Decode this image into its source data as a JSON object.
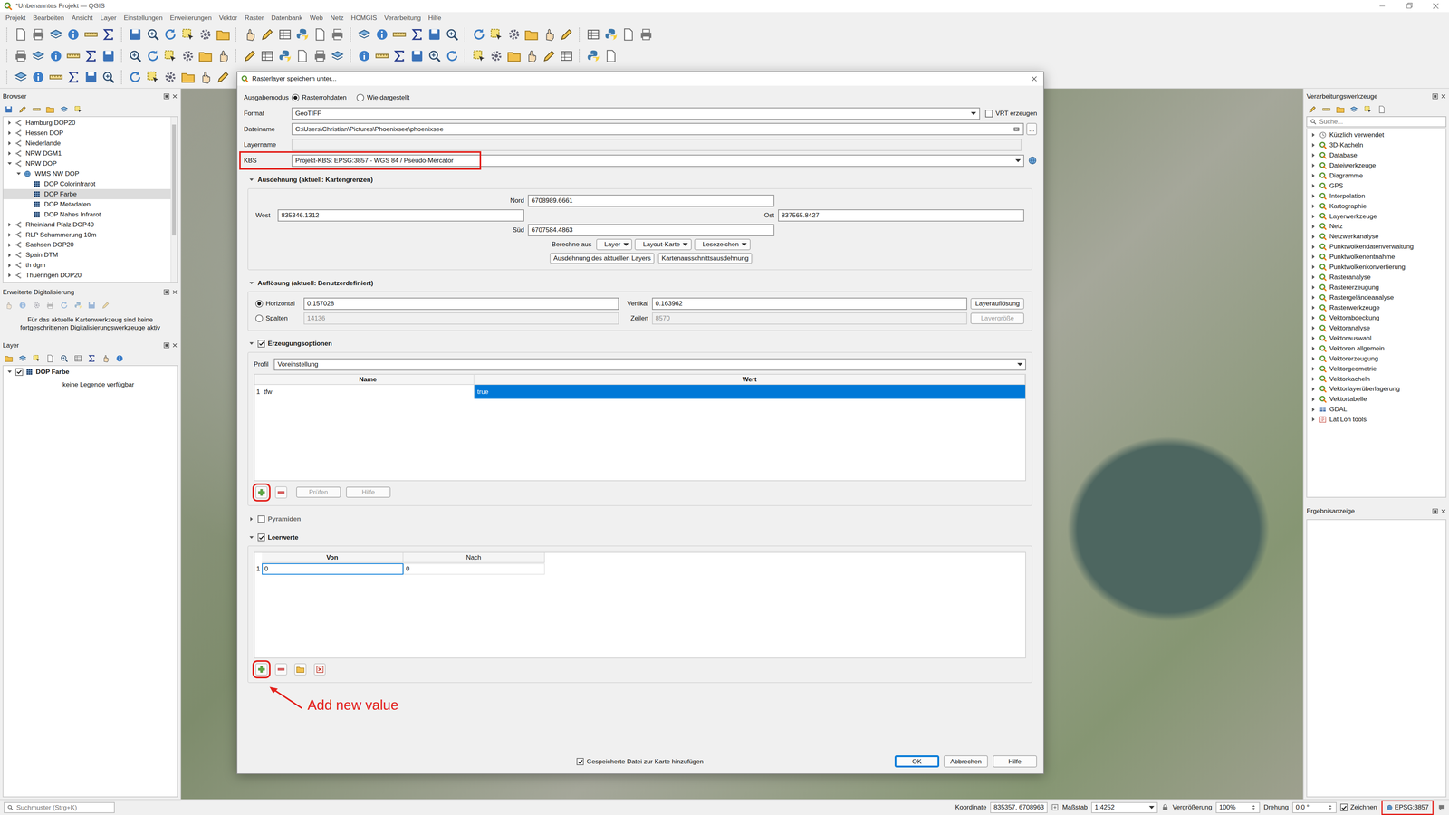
{
  "window": {
    "title": "*Unbenanntes Projekt — QGIS"
  },
  "menu": [
    "Projekt",
    "Bearbeiten",
    "Ansicht",
    "Layer",
    "Einstellungen",
    "Erweiterungen",
    "Vektor",
    "Raster",
    "Datenbank",
    "Web",
    "Netz",
    "HCMGIS",
    "Verarbeitung",
    "Hilfe"
  ],
  "browser": {
    "title": "Browser",
    "items": [
      {
        "label": "Hamburg DOP20",
        "depth": 0,
        "kind": "connection",
        "expanded": false,
        "selected": false
      },
      {
        "label": "Hessen DOP",
        "depth": 0,
        "kind": "connection",
        "expanded": false,
        "selected": false
      },
      {
        "label": "Niederlande",
        "depth": 0,
        "kind": "connection",
        "expanded": false,
        "selected": false
      },
      {
        "label": "NRW DGM1",
        "depth": 0,
        "kind": "connection",
        "expanded": false,
        "selected": false
      },
      {
        "label": "NRW DOP",
        "depth": 0,
        "kind": "connection",
        "expanded": true,
        "selected": false
      },
      {
        "label": "WMS NW DOP",
        "depth": 1,
        "kind": "service",
        "expanded": true,
        "selected": false
      },
      {
        "label": "DOP Colorinfrarot",
        "depth": 2,
        "kind": "layer",
        "expanded": false,
        "selected": false
      },
      {
        "label": "DOP Farbe",
        "depth": 2,
        "kind": "layer",
        "expanded": false,
        "selected": true
      },
      {
        "label": "DOP Metadaten",
        "depth": 2,
        "kind": "layer",
        "expanded": false,
        "selected": false
      },
      {
        "label": "DOP Nahes Infrarot",
        "depth": 2,
        "kind": "layer",
        "expanded": false,
        "selected": false
      },
      {
        "label": "Rheinland Pfalz DOP40",
        "depth": 0,
        "kind": "connection",
        "expanded": false,
        "selected": false
      },
      {
        "label": "RLP Schummerung 10m",
        "depth": 0,
        "kind": "connection",
        "expanded": false,
        "selected": false
      },
      {
        "label": "Sachsen DOP20",
        "depth": 0,
        "kind": "connection",
        "expanded": false,
        "selected": false
      },
      {
        "label": "Spain DTM",
        "depth": 0,
        "kind": "connection",
        "expanded": false,
        "selected": false
      },
      {
        "label": "th dgm",
        "depth": 0,
        "kind": "connection",
        "expanded": false,
        "selected": false
      },
      {
        "label": "Thueringen DOP20",
        "depth": 0,
        "kind": "connection",
        "expanded": false,
        "selected": false
      }
    ]
  },
  "digitizing": {
    "title": "Erweiterte Digitalisierung",
    "message": "Für das aktuelle Kartenwerkzeug sind keine fortgeschrittenen Digitalisierungswerkzeuge aktiv"
  },
  "layers": {
    "title": "Layer",
    "items": [
      {
        "label": "DOP Farbe",
        "checked": true,
        "expanded": true
      }
    ],
    "legend": "keine Legende verfügbar"
  },
  "locator": {
    "placeholder": "Suchmuster (Strg+K)"
  },
  "processing": {
    "title": "Verarbeitungswerkzeuge",
    "search": {
      "placeholder": "Suche..."
    },
    "items": [
      {
        "label": "Kürzlich verwendet",
        "kind": "recent",
        "expanded": false
      },
      {
        "label": "3D-Kacheln",
        "kind": "qgis",
        "expanded": false
      },
      {
        "label": "Database",
        "kind": "qgis",
        "expanded": false
      },
      {
        "label": "Dateiwerkzeuge",
        "kind": "qgis",
        "expanded": false
      },
      {
        "label": "Diagramme",
        "kind": "qgis",
        "expanded": false
      },
      {
        "label": "GPS",
        "kind": "qgis",
        "expanded": false
      },
      {
        "label": "Interpolation",
        "kind": "qgis",
        "expanded": false
      },
      {
        "label": "Kartographie",
        "kind": "qgis",
        "expanded": false
      },
      {
        "label": "Layerwerkzeuge",
        "kind": "qgis",
        "expanded": false
      },
      {
        "label": "Netz",
        "kind": "qgis",
        "expanded": false
      },
      {
        "label": "Netzwerkanalyse",
        "kind": "qgis",
        "expanded": false
      },
      {
        "label": "Punktwolkendatenverwaltung",
        "kind": "qgis",
        "expanded": false
      },
      {
        "label": "Punktwolkenentnahme",
        "kind": "qgis",
        "expanded": false
      },
      {
        "label": "Punktwolkenkonvertierung",
        "kind": "qgis",
        "expanded": false
      },
      {
        "label": "Rasteranalyse",
        "kind": "qgis",
        "expanded": false
      },
      {
        "label": "Rastererzeugung",
        "kind": "qgis",
        "expanded": false
      },
      {
        "label": "Rastergeländeanalyse",
        "kind": "qgis",
        "expanded": false
      },
      {
        "label": "Rasterwerkzeuge",
        "kind": "qgis",
        "expanded": false
      },
      {
        "label": "Vektorabdeckung",
        "kind": "qgis",
        "expanded": false
      },
      {
        "label": "Vektoranalyse",
        "kind": "qgis",
        "expanded": false
      },
      {
        "label": "Vektorauswahl",
        "kind": "qgis",
        "expanded": false
      },
      {
        "label": "Vektoren allgemein",
        "kind": "qgis",
        "expanded": false
      },
      {
        "label": "Vektorerzeugung",
        "kind": "qgis",
        "expanded": false
      },
      {
        "label": "Vektorgeometrie",
        "kind": "qgis",
        "expanded": false
      },
      {
        "label": "Vektorkacheln",
        "kind": "qgis",
        "expanded": false
      },
      {
        "label": "Vektorlayerüberlagerung",
        "kind": "qgis",
        "expanded": false
      },
      {
        "label": "Vektortabelle",
        "kind": "qgis",
        "expanded": false
      },
      {
        "label": "GDAL",
        "kind": "gdal",
        "expanded": false
      },
      {
        "label": "Lat Lon tools",
        "kind": "plugin",
        "expanded": false
      }
    ]
  },
  "results": {
    "title": "Ergebnisanzeige"
  },
  "status_bar": {
    "coordinate_label": "Koordinate",
    "coordinate": "835357, 6708963",
    "scale_label": "Maßstab",
    "scale": "1:4252",
    "magnifier_label": "Vergrößerung",
    "magnifier": "100%",
    "rotation_label": "Drehung",
    "rotation": "0.0 °",
    "render": {
      "label": "Zeichnen",
      "checked": true
    },
    "crs": {
      "label": "EPSG:3857",
      "highlighted": true
    }
  },
  "dialog": {
    "title": "Rasterlayer speichern unter...",
    "output_mode": {
      "label": "Ausgabemodus",
      "options": [
        {
          "label": "Rasterrohdaten",
          "selected": true
        },
        {
          "label": "Wie dargestellt",
          "selected": false
        }
      ]
    },
    "format": {
      "label": "Format",
      "value": "GeoTIFF"
    },
    "vrt": {
      "label": "VRT erzeugen",
      "checked": false
    },
    "filename": {
      "label": "Dateiname",
      "value": "C:\\Users\\Christian\\Pictures\\Phoenixsee\\phoenixsee",
      "browse": "..."
    },
    "layername": {
      "label": "Layername",
      "value": "",
      "disabled": true
    },
    "crs": {
      "label": "KBS",
      "value": "Projekt-KBS: EPSG:3857 - WGS 84 / Pseudo-Mercator",
      "highlighted": true
    },
    "extent": {
      "title": "Ausdehnung (aktuell: Kartengrenzen)",
      "expanded": true,
      "north": {
        "label": "Nord",
        "value": "6708989.6661"
      },
      "west": {
        "label": "West",
        "value": "835346.1312"
      },
      "east": {
        "label": "Ost",
        "value": "837565.8427"
      },
      "south": {
        "label": "Süd",
        "value": "6707584.4863"
      },
      "calc_label": "Berechne aus",
      "calc_menus": [
        "Layer",
        "Layout-Karte",
        "Lesezeichen"
      ],
      "buttons": [
        "Ausdehnung des aktuellen Layers",
        "Kartenausschnittsausdehnung"
      ]
    },
    "resolution": {
      "title": "Auflösung (aktuell: Benutzerdefiniert)",
      "expanded": true,
      "rows": [
        {
          "label": "Horizontal",
          "selected": true,
          "value": "0.157028",
          "label2": "Vertikal",
          "value2": "0.163962",
          "button": "Layerauflösung",
          "disabled": false
        },
        {
          "label": "Spalten",
          "selected": false,
          "value": "14136",
          "label2": "Zeilen",
          "value2": "8570",
          "button": "Layergröße",
          "disabled": true
        }
      ]
    },
    "creation": {
      "title": "Erzeugungsoptionen",
      "checked": true,
      "expanded": true,
      "profile_label": "Profil",
      "profile": "Voreinstellung",
      "columns": [
        "Name",
        "Wert"
      ],
      "rows": [
        {
          "num": "1",
          "name": "tfw",
          "value": "true",
          "selected": true
        }
      ],
      "tools": [
        {
          "kind": "add",
          "highlighted": true
        },
        {
          "kind": "remove",
          "highlighted": false
        }
      ],
      "buttons": [
        {
          "label": "Prüfen",
          "disabled": true
        },
        {
          "label": "Hilfe",
          "disabled": true
        }
      ]
    },
    "pyramids": {
      "title": "Pyramiden",
      "checked": false,
      "expanded": false
    },
    "nodata": {
      "title": "Leerwerte",
      "checked": true,
      "expanded": true,
      "columns": [
        "Von",
        "Nach"
      ],
      "rows": [
        {
          "num": "1",
          "from": "0",
          "to": "0",
          "editing": true
        }
      ],
      "tools": [
        {
          "kind": "add",
          "highlighted": true
        },
        {
          "kind": "remove",
          "highlighted": false
        },
        {
          "kind": "load",
          "highlighted": false
        },
        {
          "kind": "clear",
          "highlighted": false
        }
      ]
    },
    "add_to_map": {
      "label": "Gespeicherte Datei zur Karte hinzufügen",
      "checked": true
    },
    "buttons": [
      {
        "label": "OK",
        "default": true
      },
      {
        "label": "Abbrechen",
        "default": false
      },
      {
        "label": "Hilfe",
        "default": false
      }
    ]
  },
  "annotation": {
    "label": "Add new value",
    "color": "#e3211c"
  }
}
